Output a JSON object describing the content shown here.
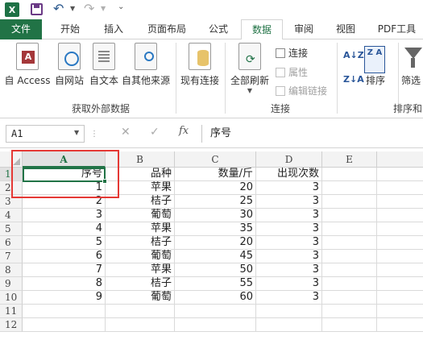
{
  "tabs": [
    "文件",
    "开始",
    "插入",
    "页面布局",
    "公式",
    "数据",
    "审阅",
    "视图",
    "PDF工具"
  ],
  "ribbon": {
    "get_external": {
      "access": "自 Access",
      "web": "自网站",
      "text": "自文本",
      "other": "自其他来源",
      "label": "获取外部数据"
    },
    "existing": "现有连接",
    "connections": {
      "refresh_all": "全部刷新",
      "connect": "连接",
      "properties": "属性",
      "edit_links": "编辑链接",
      "label": "连接"
    },
    "sort_filter": {
      "az": "A↓Z",
      "za": "Z↓A",
      "zaz": "Z A",
      "sort": "排序",
      "filter": "筛选",
      "label": "排序和"
    }
  },
  "formula_bar": {
    "name_box": "A1",
    "fx": "fx",
    "content": "序号"
  },
  "grid": {
    "columns": [
      "A",
      "B",
      "C",
      "D",
      "E"
    ],
    "rows": [
      "1",
      "2",
      "3",
      "4",
      "5",
      "6",
      "7",
      "8",
      "9",
      "10",
      "11",
      "12"
    ],
    "cells": [
      [
        "序号",
        "品种",
        "数量/斤",
        "出现次数"
      ],
      [
        "1",
        "苹果",
        "20",
        "3"
      ],
      [
        "2",
        "桔子",
        "25",
        "3"
      ],
      [
        "3",
        "葡萄",
        "30",
        "3"
      ],
      [
        "4",
        "苹果",
        "35",
        "3"
      ],
      [
        "5",
        "桔子",
        "20",
        "3"
      ],
      [
        "6",
        "葡萄",
        "45",
        "3"
      ],
      [
        "7",
        "苹果",
        "50",
        "3"
      ],
      [
        "8",
        "桔子",
        "55",
        "3"
      ],
      [
        "9",
        "葡萄",
        "60",
        "3"
      ]
    ]
  },
  "colors": {
    "excel_green": "#217346",
    "annotation_red": "#e53935"
  }
}
